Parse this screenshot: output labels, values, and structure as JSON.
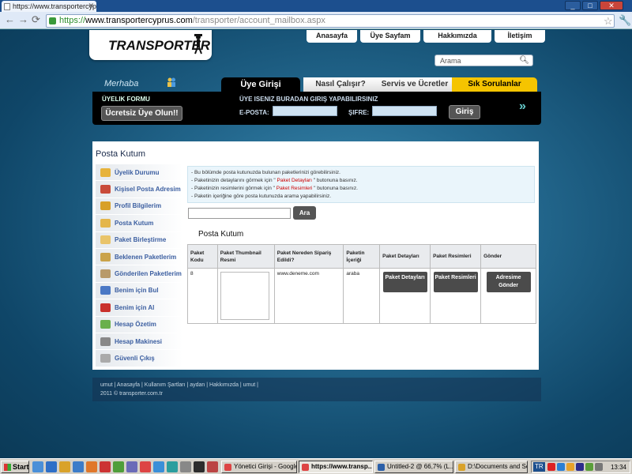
{
  "browser": {
    "tab_title": "https://www.transportercyp",
    "url_scheme": "https://",
    "url_domain": "www.transportercyprus.com",
    "url_path": "/transporter/account_mailbox.aspx"
  },
  "site": {
    "logo_text": "TRANSPORTER",
    "topnav": [
      "Anasayfa",
      "Üye Sayfam",
      "Hakkımızda",
      "İletişim"
    ],
    "search_placeholder": "Arama",
    "greeting": "Merhaba",
    "tabs": {
      "uye": "Üye Girişi",
      "nasil": "Nasıl Çalışır?",
      "servis": "Servis ve Ücretler",
      "sss": "Sık Sorulanlar"
    }
  },
  "login": {
    "form_label": "ÜYELIK FORMU",
    "register_button": "Ücretsiz Üye Olun!!",
    "heading": "ÜYE ISENIZ BURADAN GIRIŞ YAPABILIRSINIZ",
    "email_label": "E-POSTA:",
    "password_label": "ŞIFRE:",
    "login_button": "Giriş"
  },
  "mailbox": {
    "title": "Posta Kutum",
    "sidebar": [
      {
        "label": "Üyelik Durumu",
        "color": "#e7b33b"
      },
      {
        "label": "Kişisel Posta Adresim",
        "color": "#c94b3a"
      },
      {
        "label": "Profil Bilgilerim",
        "color": "#d8a028"
      },
      {
        "label": "Posta Kutum",
        "color": "#e4b64b"
      },
      {
        "label": "Paket Birleştirme",
        "color": "#e9c46a"
      },
      {
        "label": "Beklenen Paketlerim",
        "color": "#caa34a"
      },
      {
        "label": "Gönderilen Paketlerim",
        "color": "#b89a6a"
      },
      {
        "label": "Benim için Bul",
        "color": "#4a78c5"
      },
      {
        "label": "Benim için Al",
        "color": "#c9302c"
      },
      {
        "label": "Hesap Özetim",
        "color": "#6ab04c"
      },
      {
        "label": "Hesap Makinesi",
        "color": "#888"
      },
      {
        "label": "Güvenli Çıkış",
        "color": "#aaa"
      }
    ],
    "info_lines": [
      {
        "pre": "- Bu bölümde posta kutunuzda bulunan paketlerinizi görebilirsiniz.",
        "red": "",
        "post": ""
      },
      {
        "pre": "- Paketinizin detaylarını görmek için \"",
        "red": " Paket Detayları ",
        "post": "\" butonuna basınız."
      },
      {
        "pre": "- Paketinizin resimlerini görmek için \"",
        "red": " Paket Resimleri ",
        "post": "\" butonuna basınız."
      },
      {
        "pre": "- Paketin içeriğine göre posta kutunuzda arama yapabilirsiniz.",
        "red": "",
        "post": ""
      }
    ],
    "search_button": "Ara",
    "table_title": "Posta Kutum",
    "columns": [
      "Paket Kodu",
      "Paket Thumbnail Resmi",
      "Paket Nereden Sipariş Edildi?",
      "Paketin İçeriği",
      "Paket Detayları",
      "Paket Resimleri",
      "Gönder"
    ],
    "row": {
      "code": "8",
      "source": "www.deneme.com",
      "content": "araba",
      "detail_btn": "Paket Detayları",
      "images_btn": "Paket Resimleri",
      "send_btn": "Adresime Gönder"
    }
  },
  "footer": {
    "links": "umut  |  Anasayfa  |  Kullanım Şartları  |  aydan  |  Hakkımızda  |  umut  |",
    "copyright": "2011 © transporter.com.tr"
  },
  "taskbar": {
    "start": "Start",
    "apps": [
      "Yönetici Girişi - Google ...",
      "https://www.transp...",
      "Untitled-2 @ 66,7% (L...",
      "D:\\Documents and Set..."
    ],
    "lang": "TR",
    "clock": "13:34"
  }
}
